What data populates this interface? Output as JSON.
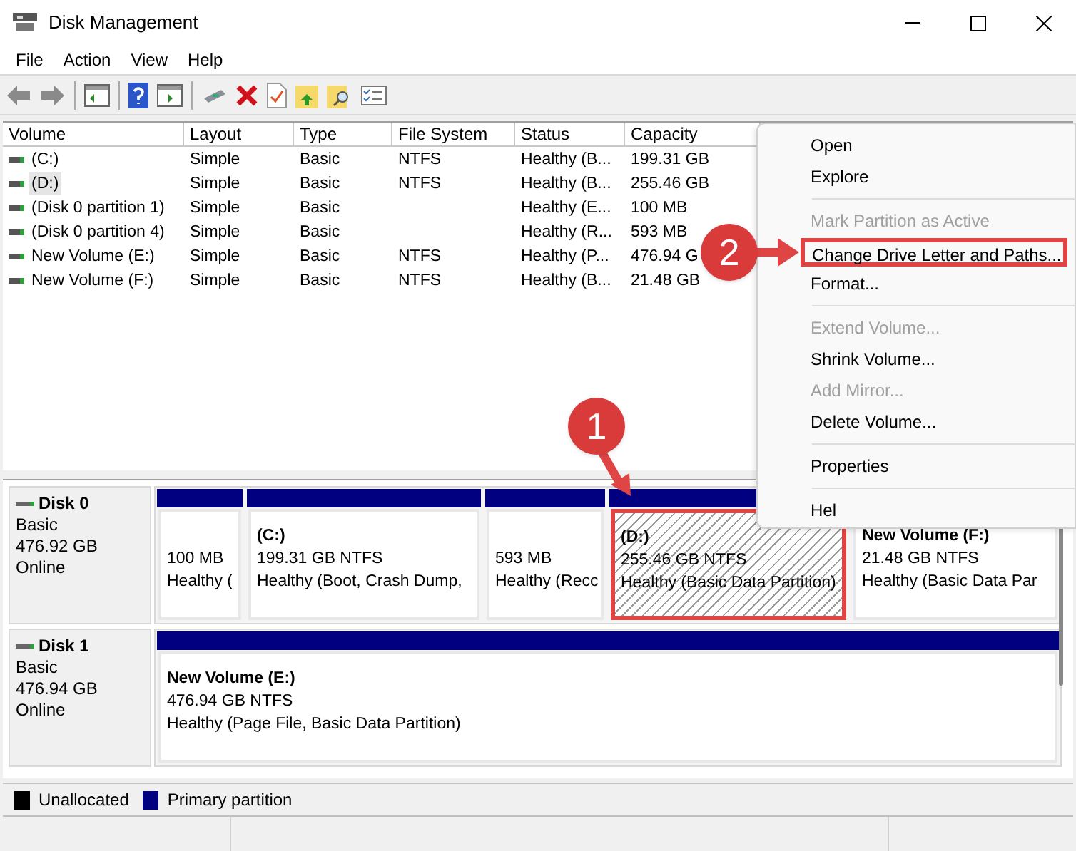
{
  "window": {
    "title": "Disk Management"
  },
  "menu_bar": [
    "File",
    "Action",
    "View",
    "Help"
  ],
  "volume_table": {
    "columns": [
      "Volume",
      "Layout",
      "Type",
      "File System",
      "Status",
      "Capacity"
    ],
    "rows": [
      {
        "selected": false,
        "cells": [
          "(C:)",
          "Simple",
          "Basic",
          "NTFS",
          "Healthy (B...",
          "199.31 GB"
        ]
      },
      {
        "selected": true,
        "cells": [
          "(D:)",
          "Simple",
          "Basic",
          "NTFS",
          "Healthy (B...",
          "255.46 GB"
        ]
      },
      {
        "selected": false,
        "cells": [
          "(Disk 0 partition 1)",
          "Simple",
          "Basic",
          "",
          "Healthy (E...",
          "100 MB"
        ]
      },
      {
        "selected": false,
        "cells": [
          "(Disk 0 partition 4)",
          "Simple",
          "Basic",
          "",
          "Healthy (R...",
          "593 MB"
        ]
      },
      {
        "selected": false,
        "cells": [
          "New Volume (E:)",
          "Simple",
          "Basic",
          "NTFS",
          "Healthy (P...",
          "476.94 G"
        ]
      },
      {
        "selected": false,
        "cells": [
          "New Volume (F:)",
          "Simple",
          "Basic",
          "NTFS",
          "Healthy (B...",
          "21.48 GB"
        ]
      }
    ]
  },
  "disks": [
    {
      "name": "Disk 0",
      "type": "Basic",
      "size": "476.92 GB",
      "state": "Online",
      "partitions": [
        {
          "selected": false,
          "highlighted": false,
          "size": "100 MB",
          "status": "Healthy ("
        },
        {
          "selected": false,
          "highlighted": false,
          "name": "(C:)",
          "size": "199.31 GB NTFS",
          "status": "Healthy (Boot, Crash Dump,"
        },
        {
          "selected": false,
          "highlighted": false,
          "size": "593 MB",
          "status": "Healthy (Recc"
        },
        {
          "selected": true,
          "highlighted": true,
          "name": "(D:)",
          "size": "255.46 GB NTFS",
          "status": "Healthy (Basic Data Partition)"
        },
        {
          "selected": false,
          "highlighted": false,
          "name": "New Volume  (F:)",
          "size": "21.48 GB NTFS",
          "status": "Healthy (Basic Data Par"
        }
      ]
    },
    {
      "name": "Disk 1",
      "type": "Basic",
      "size": "476.94 GB",
      "state": "Online",
      "partitions": [
        {
          "selected": false,
          "highlighted": false,
          "name": "New Volume  (E:)",
          "size": "476.94 GB NTFS",
          "status": "Healthy (Page File, Basic Data Partition)"
        }
      ]
    }
  ],
  "legend": [
    {
      "label": "Unallocated",
      "color": "#000000"
    },
    {
      "label": "Primary partition",
      "color": "#000080"
    }
  ],
  "context_menu": [
    {
      "kind": "item",
      "label": "Open",
      "disabled": false,
      "highlighted": false
    },
    {
      "kind": "item",
      "label": "Explore",
      "disabled": false,
      "highlighted": false
    },
    {
      "kind": "separator"
    },
    {
      "kind": "item",
      "label": "Mark Partition as Active",
      "disabled": true,
      "highlighted": false
    },
    {
      "kind": "item",
      "label": "Change Drive Letter and Paths...",
      "disabled": false,
      "highlighted": true
    },
    {
      "kind": "item",
      "label": "Format...",
      "disabled": false,
      "highlighted": false
    },
    {
      "kind": "separator"
    },
    {
      "kind": "item",
      "label": "Extend Volume...",
      "disabled": true,
      "highlighted": false
    },
    {
      "kind": "item",
      "label": "Shrink Volume...",
      "disabled": false,
      "highlighted": false
    },
    {
      "kind": "item",
      "label": "Add Mirror...",
      "disabled": true,
      "highlighted": false
    },
    {
      "kind": "item",
      "label": "Delete Volume...",
      "disabled": false,
      "highlighted": false
    },
    {
      "kind": "separator"
    },
    {
      "kind": "item",
      "label": "Properties",
      "disabled": false,
      "highlighted": false
    },
    {
      "kind": "separator"
    },
    {
      "kind": "item",
      "label": "Hel",
      "disabled": false,
      "highlighted": false
    }
  ],
  "annotations": [
    {
      "label": "1"
    },
    {
      "label": "2"
    }
  ]
}
